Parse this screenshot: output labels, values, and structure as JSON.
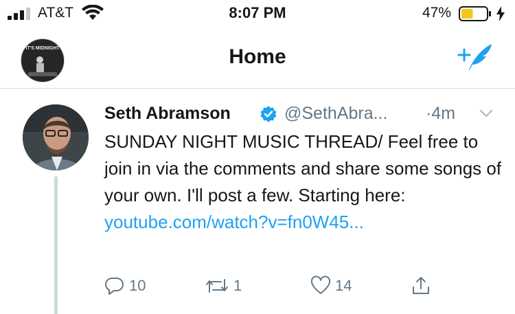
{
  "status_bar": {
    "carrier": "AT&T",
    "time": "8:07 PM",
    "battery_percent": "47%",
    "battery_level": 0.47,
    "battery_color": "#f5c518",
    "icons": [
      "signal-icon",
      "wifi-icon",
      "battery-icon",
      "charging-bolt-icon"
    ]
  },
  "navbar": {
    "title": "Home",
    "profile_avatar_text": "IT'S MIDNIGHT",
    "compose_icon": "compose-tweet-icon"
  },
  "tweet": {
    "display_name": "Seth Abramson",
    "verified": true,
    "handle": "@SethAbra...",
    "separator": "·",
    "timestamp": "4m",
    "text_prefix": "SUNDAY NIGHT MUSIC THREAD/ Feel free to join in via the comments and share some songs of your own. I'll post a few. Starting here: ",
    "link_text": "youtube.com/watch?v=fn0W45...",
    "actions": {
      "replies": "10",
      "retweets": "1",
      "likes": "14"
    }
  },
  "colors": {
    "accent": "#1da1f2",
    "secondary_text": "#657786",
    "divider": "#d9dde1"
  }
}
